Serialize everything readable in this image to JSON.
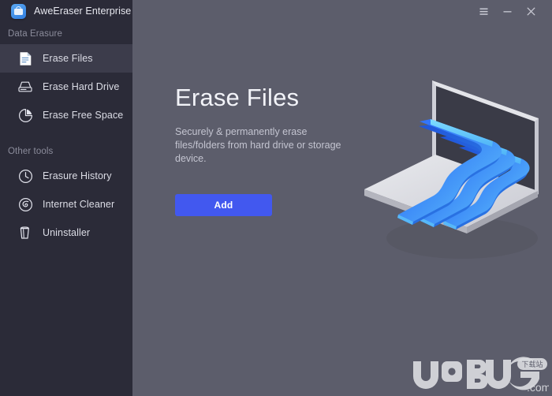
{
  "window": {
    "title": "AweEraser Enterprise",
    "app_icon": "app-logo-icon",
    "controls": [
      {
        "name": "menu",
        "icon": "hamburger-menu-icon"
      },
      {
        "name": "minimize",
        "icon": "minimize-icon"
      },
      {
        "name": "close",
        "icon": "close-icon"
      }
    ]
  },
  "sidebar": {
    "groups": [
      {
        "label": "Data Erasure",
        "items": [
          {
            "label": "Erase Files",
            "icon": "document-icon",
            "active": true
          },
          {
            "label": "Erase Hard Drive",
            "icon": "hard-drive-icon",
            "active": false
          },
          {
            "label": "Erase Free Space",
            "icon": "pie-chart-icon",
            "active": false
          }
        ]
      },
      {
        "label": "Other tools",
        "items": [
          {
            "label": "Erasure History",
            "icon": "clock-icon",
            "active": false
          },
          {
            "label": "Internet Cleaner",
            "icon": "globe-swirl-icon",
            "active": false
          },
          {
            "label": "Uninstaller",
            "icon": "trash-bin-icon",
            "active": false
          }
        ]
      }
    ]
  },
  "main": {
    "heading": "Erase Files",
    "description": "Securely & permanently erase files/folders from hard drive or storage device.",
    "add_label": "Add",
    "illustration": "isometric-laptop-with-blue-data-ribbons"
  },
  "watermark": {
    "text_1": "U",
    "text_2": "BUG",
    "badge": "下载站",
    "suffix": ".com"
  },
  "colors": {
    "sidebar_bg": "#2b2b38",
    "sidebar_active": "#3c3c4b",
    "main_bg": "#5c5d6b",
    "accent": "#4258ef",
    "heading": "#f2f3f8",
    "muted_text": "#8b8c9b"
  }
}
